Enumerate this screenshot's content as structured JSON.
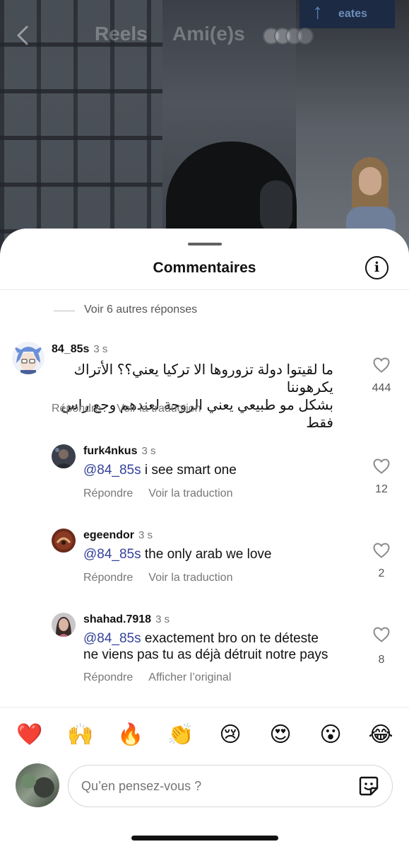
{
  "header": {
    "tab_reels": "Reels",
    "tab_friends": "Ami(e)s",
    "bg_sign": "eates"
  },
  "sheet": {
    "title": "Commentaires",
    "info_icon": "info-icon",
    "more_replies": "Voir 6 autres réponses"
  },
  "comments": [
    {
      "username": "84_85s",
      "time": "3 s",
      "text_line1": "ما لقيتوا دولة تزوروها الا تركيا يعني؟؟ الأتراك يكرهوننا",
      "text_line2": "بشكل مو طبيعي يعني الروحة لعندهم وجع راس فقط",
      "reply_label": "Répondre",
      "translate_label": "Voir la traduction",
      "likes": "444"
    },
    {
      "username": "furk4nkus",
      "time": "3 s",
      "mention": "@84_85s",
      "text": " i see smart one",
      "reply_label": "Répondre",
      "translate_label": "Voir la traduction",
      "likes": "12"
    },
    {
      "username": "egeendor",
      "time": "3 s",
      "mention": "@84_85s",
      "text": " the only arab we love",
      "reply_label": "Répondre",
      "translate_label": "Voir la traduction",
      "likes": "2"
    },
    {
      "username": "shahad.7918",
      "time": "3 s",
      "mention": "@84_85s",
      "text_line1": " exactement bro on te déteste",
      "text_line2": "ne viens pas tu as déjà détruit notre pays",
      "reply_label": "Répondre",
      "translate_label": "Afficher l’original",
      "likes": "8"
    }
  ],
  "reactions": [
    "❤️",
    "🙌",
    "🔥",
    "👏",
    "😢",
    "😍",
    "😮",
    "😂"
  ],
  "composer": {
    "placeholder": "Qu’en pensez-vous ?"
  },
  "colors": {
    "mention": "#36429b",
    "like_icon": "#8a8a8a",
    "sheet_bg": "#ffffff"
  }
}
